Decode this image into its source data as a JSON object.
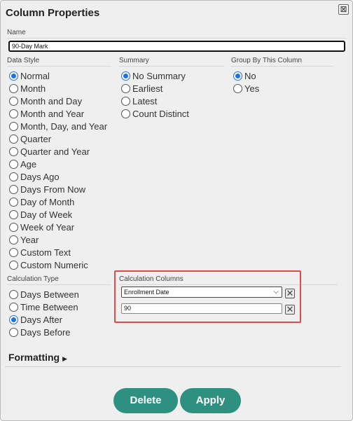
{
  "dialog": {
    "title": "Column Properties",
    "close_glyph": "⊠"
  },
  "name_section": {
    "label": "Name",
    "value": "90-Day Mark"
  },
  "data_style": {
    "label": "Data Style",
    "options": [
      {
        "label": "Normal",
        "checked": true
      },
      {
        "label": "Month",
        "checked": false
      },
      {
        "label": "Month and Day",
        "checked": false
      },
      {
        "label": "Month and Year",
        "checked": false
      },
      {
        "label": "Month, Day, and Year",
        "checked": false
      },
      {
        "label": "Quarter",
        "checked": false
      },
      {
        "label": "Quarter and Year",
        "checked": false
      },
      {
        "label": "Age",
        "checked": false
      },
      {
        "label": "Days Ago",
        "checked": false
      },
      {
        "label": "Days From Now",
        "checked": false
      },
      {
        "label": "Day of Month",
        "checked": false
      },
      {
        "label": "Day of Week",
        "checked": false
      },
      {
        "label": "Week of Year",
        "checked": false
      },
      {
        "label": "Year",
        "checked": false
      },
      {
        "label": "Custom Text",
        "checked": false
      },
      {
        "label": "Custom Numeric",
        "checked": false
      }
    ]
  },
  "summary": {
    "label": "Summary",
    "options": [
      {
        "label": "No Summary",
        "checked": true
      },
      {
        "label": "Earliest",
        "checked": false
      },
      {
        "label": "Latest",
        "checked": false
      },
      {
        "label": "Count Distinct",
        "checked": false
      }
    ]
  },
  "group_by": {
    "label": "Group By This Column",
    "options": [
      {
        "label": "No",
        "checked": true
      },
      {
        "label": "Yes",
        "checked": false
      }
    ]
  },
  "calculation_type": {
    "label": "Calculation Type",
    "options": [
      {
        "label": "Days Between",
        "checked": false
      },
      {
        "label": "Time Between",
        "checked": false
      },
      {
        "label": "Days After",
        "checked": true
      },
      {
        "label": "Days Before",
        "checked": false
      }
    ]
  },
  "calculation_columns": {
    "label": "Calculation Columns",
    "select_value": "Enrollment Date",
    "input_value": "90",
    "remove_glyph": "✕",
    "highlight_color": "#e04a4a"
  },
  "formatting": {
    "label": "Formatting",
    "arrow": "▶"
  },
  "buttons": {
    "delete_label": "Delete",
    "apply_label": "Apply",
    "color": "#2e9080"
  }
}
